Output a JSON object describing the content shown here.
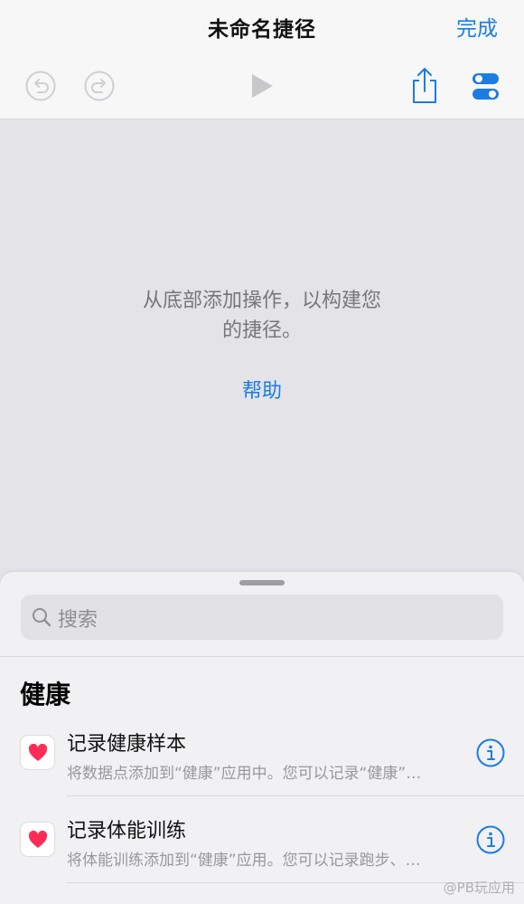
{
  "header": {
    "title": "未命名捷径",
    "done_label": "完成"
  },
  "toolbar": {
    "icons": [
      "undo-icon",
      "redo-icon",
      "play-icon",
      "share-icon",
      "settings-toggle-icon"
    ]
  },
  "empty_state": {
    "message_line1": "从底部添加操作，以构建您",
    "message_line2": "的捷径。",
    "help_label": "帮助"
  },
  "sheet": {
    "search_placeholder": "搜索",
    "section_title": "健康",
    "actions": [
      {
        "title": "记录健康样本",
        "subtitle": "将数据点添加到“健康”应用中。您可以记录“健康”…",
        "icon": "heart-icon"
      },
      {
        "title": "记录体能训练",
        "subtitle": "将体能训练添加到“健康”应用。您可以记录跑步、…",
        "icon": "heart-icon"
      }
    ]
  },
  "watermark": "@PB玩应用",
  "colors": {
    "accent": "#1c7ce6",
    "heart": "#ff2d55",
    "background": "#e3e3e8",
    "sheet": "#f1f1f4"
  }
}
